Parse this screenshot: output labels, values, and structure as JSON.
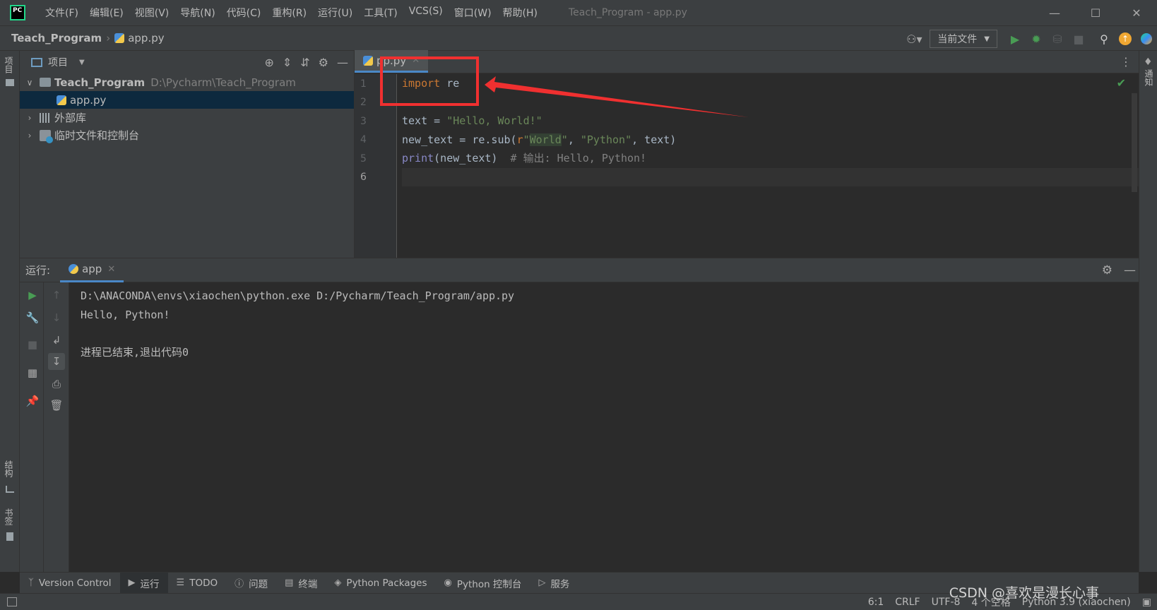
{
  "titlebar": {
    "menu": [
      "文件(F)",
      "编辑(E)",
      "视图(V)",
      "导航(N)",
      "代码(C)",
      "重构(R)",
      "运行(U)",
      "工具(T)",
      "VCS(S)",
      "窗口(W)",
      "帮助(H)"
    ],
    "window_title": "Teach_Program - app.py"
  },
  "navbar": {
    "project": "Teach_Program",
    "file": "app.py",
    "run_config": "当前文件"
  },
  "left_stripe": {
    "project": "项目",
    "structure": "结构",
    "bookmarks": "书签"
  },
  "right_stripe": {
    "notifications": "通知"
  },
  "project_panel": {
    "title": "项目",
    "root_name": "Teach_Program",
    "root_path": "D:\\Pycharm\\Teach_Program",
    "file": "app.py",
    "external_libs": "外部库",
    "scratches": "临时文件和控制台"
  },
  "editor": {
    "tab_label": "pp.py",
    "line_numbers": [
      "1",
      "2",
      "3",
      "4",
      "5",
      "6"
    ],
    "lines": {
      "l1_kw": "import",
      "l1_rest": " re",
      "l3_a": "text = ",
      "l3_str": "\"Hello, World!\"",
      "l4_a": "new_text = re.sub(",
      "l4_r": "r",
      "l4_q1": "\"",
      "l4_world": "World",
      "l4_q2": "\"",
      "l4_comma": ", ",
      "l4_python": "\"Python\"",
      "l4_end": ", text)",
      "l5_print": "print",
      "l5_args": "(new_text)  ",
      "l5_comment": "# 输出: Hello, Python!"
    }
  },
  "run_panel": {
    "label": "运行:",
    "tab": "app",
    "console": [
      "D:\\ANACONDA\\envs\\xiaochen\\python.exe D:/Pycharm/Teach_Program/app.py",
      "Hello, Python!",
      "",
      "进程已结束,退出代码0"
    ]
  },
  "bottom_tabs": [
    "Version Control",
    "运行",
    "TODO",
    "问题",
    "终端",
    "Python Packages",
    "Python 控制台",
    "服务"
  ],
  "status": {
    "position": "6:1",
    "line_sep": "CRLF",
    "encoding": "UTF-8",
    "indent": "4 个空格",
    "interpreter": "Python 3.9 (xiaochen)"
  },
  "watermark": "CSDN @喜欢是漫长心事",
  "colors": {
    "annotation_red": "#f03030",
    "accent_blue": "#4a88c7",
    "keyword": "#cc7832",
    "string": "#6a8759"
  }
}
